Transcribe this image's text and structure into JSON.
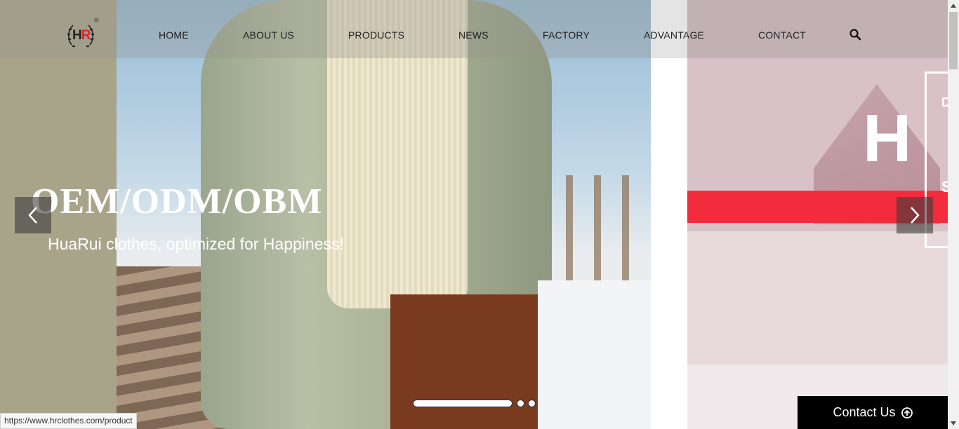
{
  "header": {
    "logo_text": "HR",
    "logo_mark": "®",
    "nav": {
      "home": "HOME",
      "about": "ABOUT US",
      "products": "PRODUCTS",
      "news": "NEWS",
      "factory": "FACTORY",
      "advantage": "ADVANTAGE",
      "contact": "CONTACT"
    },
    "search_icon": "search-icon"
  },
  "hero": {
    "title": "OEM/ODM/OBM",
    "subtitle": "HuaRui clothes, optimized for Happiness!",
    "next_slide_letter": "H",
    "next_slide_frame_top": "D",
    "next_slide_frame_bottom": "S",
    "prev_icon": "chevron-left-icon",
    "next_icon": "chevron-right-icon",
    "active_slide": 1,
    "slide_count": 3
  },
  "contact_button": {
    "label": "Contact Us",
    "icon": "arrow-up-circle-icon"
  },
  "status_bar": {
    "url": "https://www.hrclothes.com/product"
  },
  "colors": {
    "accent_red": "#f22c3d",
    "logo_red": "#e0232e",
    "contact_bg": "#000000"
  }
}
